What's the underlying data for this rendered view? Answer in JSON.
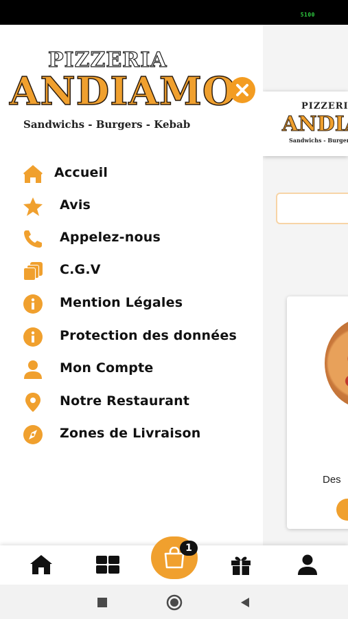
{
  "status_bar": {
    "signal_text": "5100"
  },
  "logo": {
    "line1": "PIZZERIA",
    "line2": "ANDIAMO",
    "line3": "Sandwichs - Burgers - Kebab"
  },
  "menu": {
    "items": [
      {
        "label": "Accueil",
        "icon": "home-icon"
      },
      {
        "label": "Avis",
        "icon": "star-icon"
      },
      {
        "label": "Appelez-nous",
        "icon": "phone-icon"
      },
      {
        "label": "C.G.V",
        "icon": "documents-icon"
      },
      {
        "label": "Mention Légales",
        "icon": "info-icon"
      },
      {
        "label": "Protection des données",
        "icon": "info-icon"
      },
      {
        "label": "Mon Compte",
        "icon": "person-icon"
      },
      {
        "label": "Notre Restaurant",
        "icon": "location-pin-icon"
      },
      {
        "label": "Zones de Livraison",
        "icon": "compass-icon"
      }
    ]
  },
  "background_page": {
    "product_text": "Des"
  },
  "bottom_nav": {
    "items": [
      "home-icon",
      "grid-icon",
      "cart-icon",
      "gift-icon",
      "person-icon"
    ],
    "cart_count": "1"
  },
  "colors": {
    "accent": "#f0a02e",
    "text": "#111111"
  }
}
